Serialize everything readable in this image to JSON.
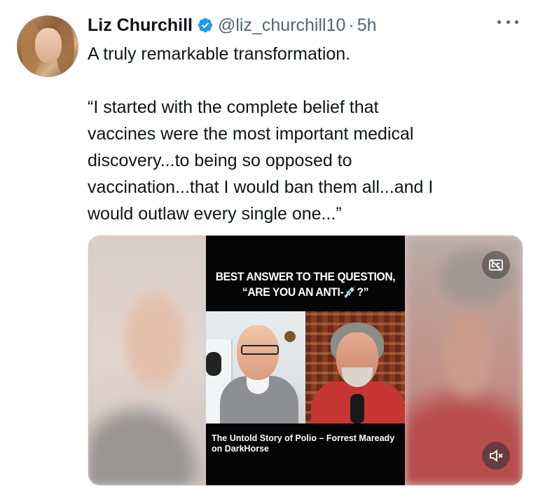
{
  "tweet": {
    "author_name": "Liz Churchill",
    "handle": "@liz_churchill10",
    "separator": "·",
    "time": "5h",
    "lines": [
      "A truly remarkable transformation.",
      "“I started with the complete belief that",
      "vaccines were the most important medical",
      "discovery...to being so opposed to",
      "vaccination...that I would ban them all...and I",
      "would outlaw every single one...”"
    ]
  },
  "media": {
    "headline_line1": "BEST ANSWER TO THE QUESTION,",
    "headline_line2": "“ARE YOU AN ANTI-",
    "headline_line2_end": "?”",
    "headline_emoji": "💉",
    "caption": "The Untold Story of Polio – Forrest Maready on DarkHorse"
  },
  "icons": {
    "verified": "verified-badge-icon",
    "more": "more-options-icon",
    "captions": "closed-captions-off-icon",
    "mute": "volume-muted-icon"
  },
  "colors": {
    "verified_blue": "#1d9bf0",
    "secondary_text": "#536471",
    "primary_text": "#0f1419"
  }
}
